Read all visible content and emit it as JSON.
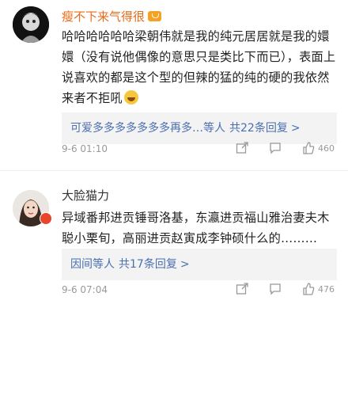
{
  "comments": [
    {
      "username": "瘦不下来气得很",
      "text": "哈哈哈哈哈哈梁朝伟就是我的纯元居居就是我的嬛嬛（没有说他偶像的意思只是类比下而已），表面上说喜欢的都是这个型的但辣的猛的纯的硬的我依然来者不拒吼",
      "reply_users": "可爱多多多多多多多再多…等人",
      "reply_link": "共22条回复",
      "reply_chevron": ">",
      "time": "9-6 01:10",
      "likes": "460"
    },
    {
      "username": "大脸猫力",
      "text": "异域番邦进贡锤哥洛基，东瀛进贡福山雅治妻夫木聪小栗旬，高丽进贡赵寅成李钟硕什么的………",
      "reply_users": "因间等人",
      "reply_link": "共17条回复",
      "reply_chevron": ">",
      "time": "9-6 07:04",
      "likes": "476"
    }
  ],
  "icons": {
    "share": "share-icon",
    "comment": "comment-icon",
    "like": "thumbs-up-icon",
    "level_badge": "level-badge-icon",
    "emoji": "laughing-emoji-icon",
    "verified": "verified-badge-icon"
  },
  "colors": {
    "username_highlight": "#e86b1a",
    "link": "#4a6fb0",
    "reply_box_bg": "#f3f3f3",
    "meta": "#999999"
  }
}
